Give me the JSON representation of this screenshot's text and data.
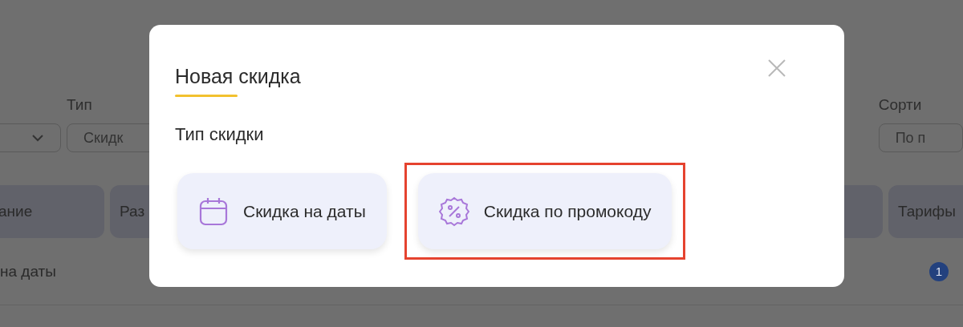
{
  "background": {
    "filters": [
      {
        "kind": "select"
      },
      {
        "label": "Тип",
        "value": "Скидк",
        "kind": "input"
      },
      {
        "label": "Сорти",
        "value": "По п",
        "kind": "input"
      }
    ],
    "table": {
      "columns": [
        "ание",
        "Раз",
        null,
        "Тарифы"
      ],
      "rows": [
        {
          "column_1": "на даты",
          "badge": "1"
        }
      ]
    }
  },
  "modal": {
    "title": "Новая скидка",
    "section_title": "Тип скидки",
    "options": [
      {
        "label": "Скидка на даты",
        "kind": "calendar",
        "highlighted": false
      },
      {
        "label": "Скидка по промокоду",
        "kind": "promo",
        "highlighted": true
      }
    ]
  }
}
